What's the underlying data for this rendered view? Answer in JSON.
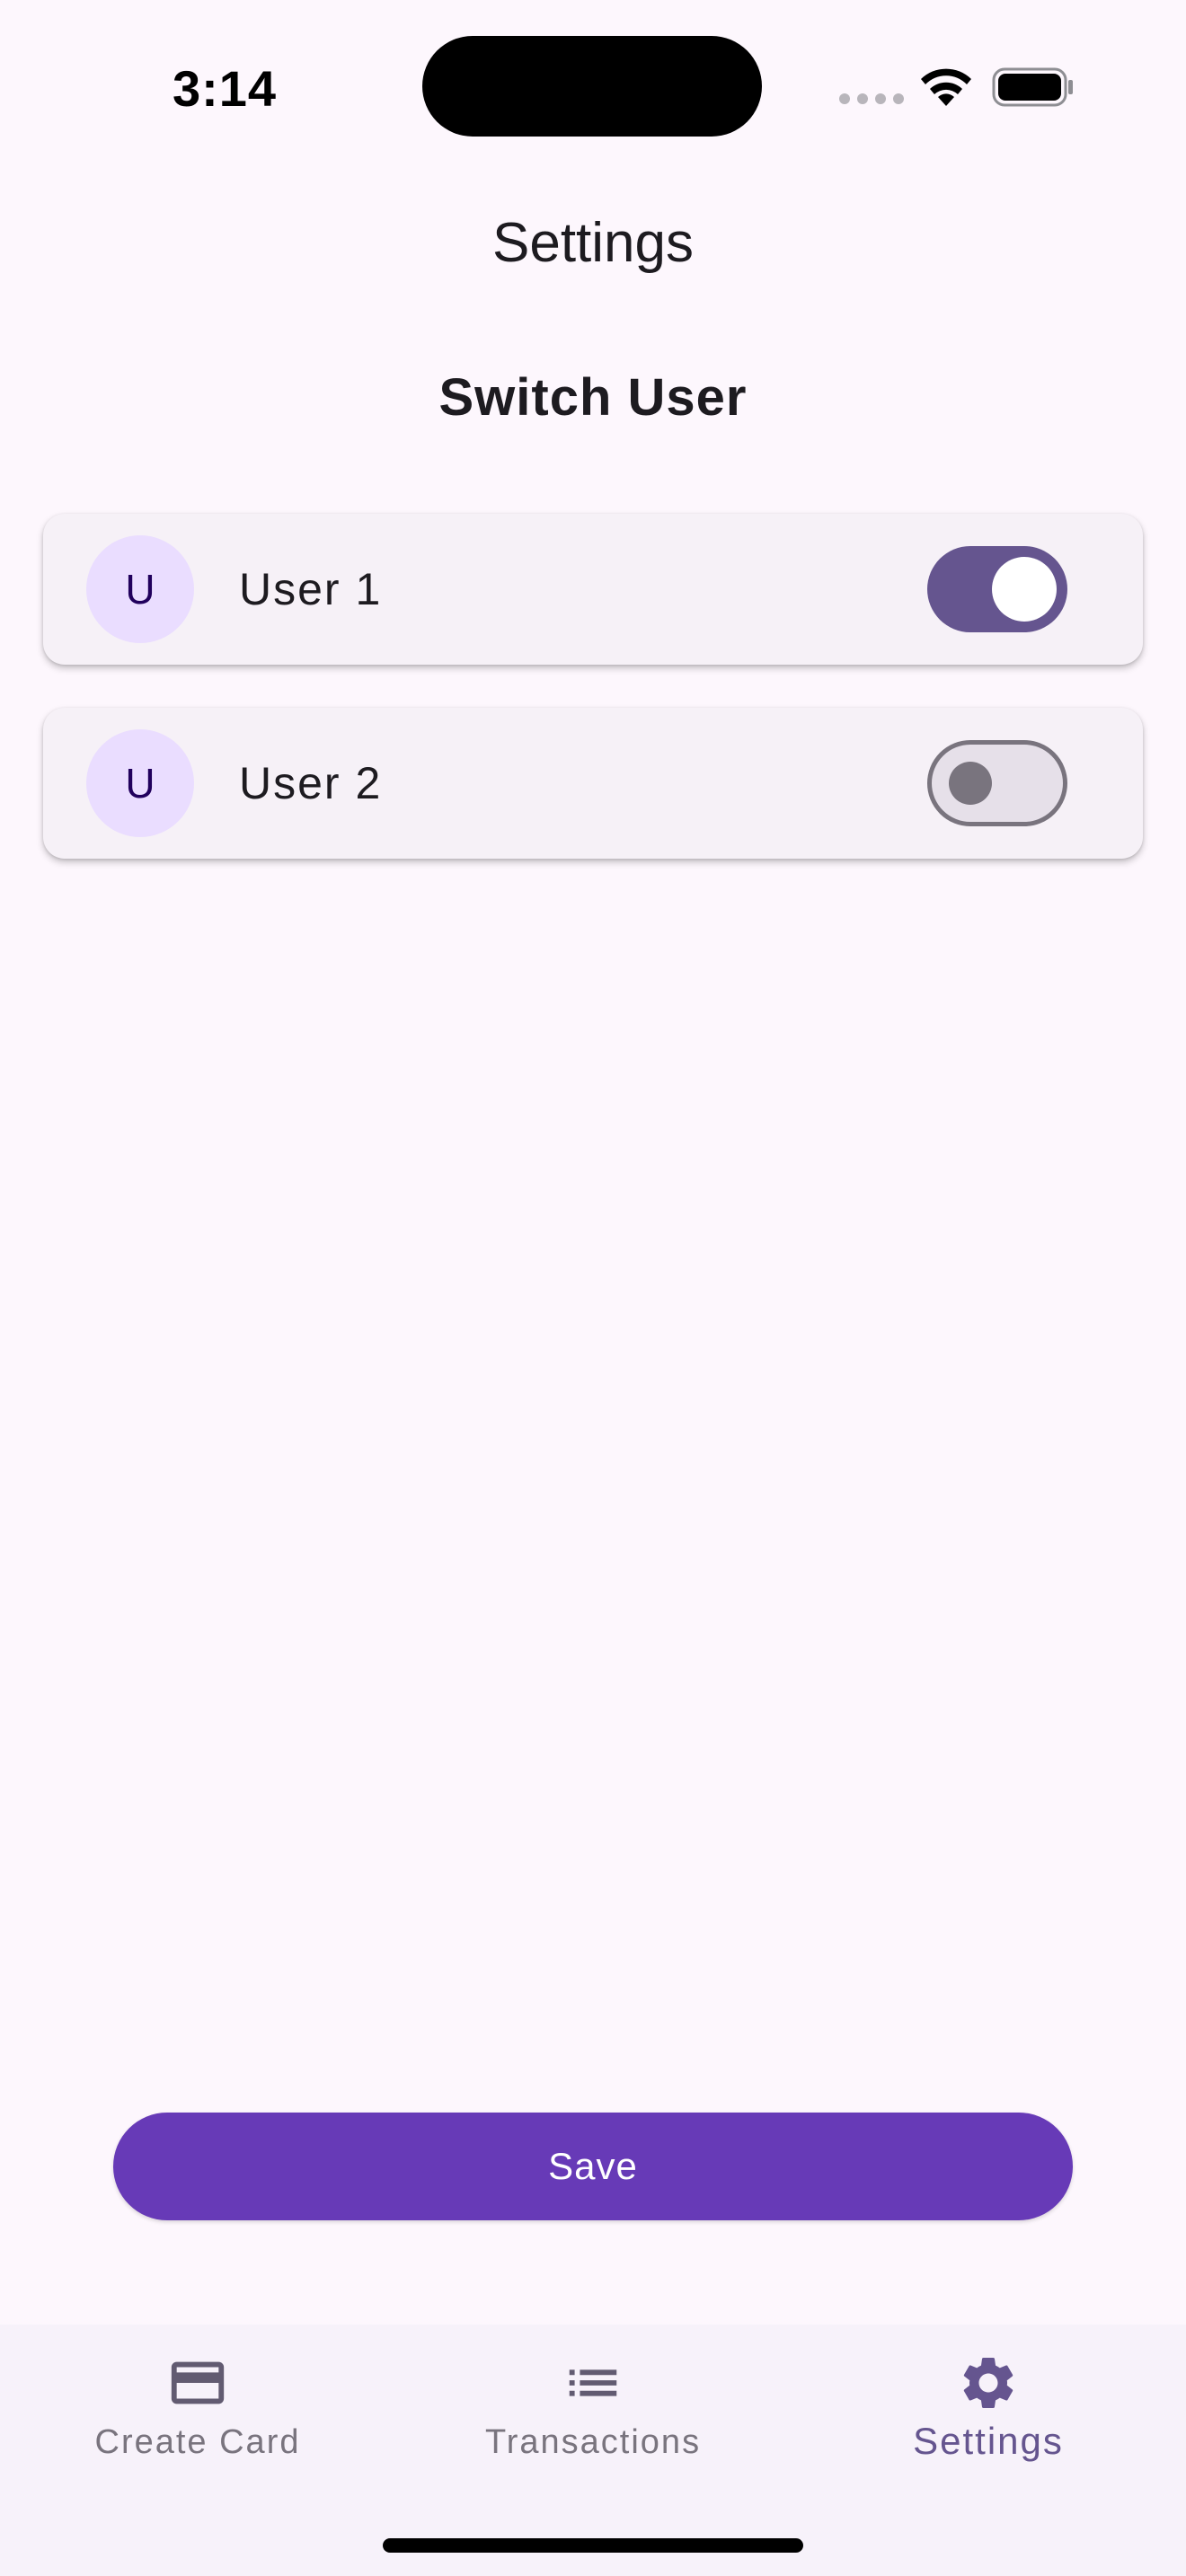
{
  "status_bar": {
    "time": "3:14"
  },
  "header": {
    "title": "Settings"
  },
  "section": {
    "title": "Switch User"
  },
  "users": [
    {
      "avatar_initial": "U",
      "name": "User 1",
      "selected": true
    },
    {
      "avatar_initial": "U",
      "name": "User 2",
      "selected": false
    }
  ],
  "actions": {
    "save_label": "Save"
  },
  "bottom_nav": {
    "items": [
      {
        "label": "Create Card",
        "icon": "credit-card-icon",
        "active": false
      },
      {
        "label": "Transactions",
        "icon": "list-icon",
        "active": false
      },
      {
        "label": "Settings",
        "icon": "gear-icon",
        "active": true
      }
    ]
  },
  "colors": {
    "background": "#fdf7fd",
    "primary_button": "#673ab7",
    "switch_on": "#65558f",
    "avatar_bg": "#eaddff",
    "nav_active": "#65558f",
    "nav_inactive": "#79747e"
  }
}
